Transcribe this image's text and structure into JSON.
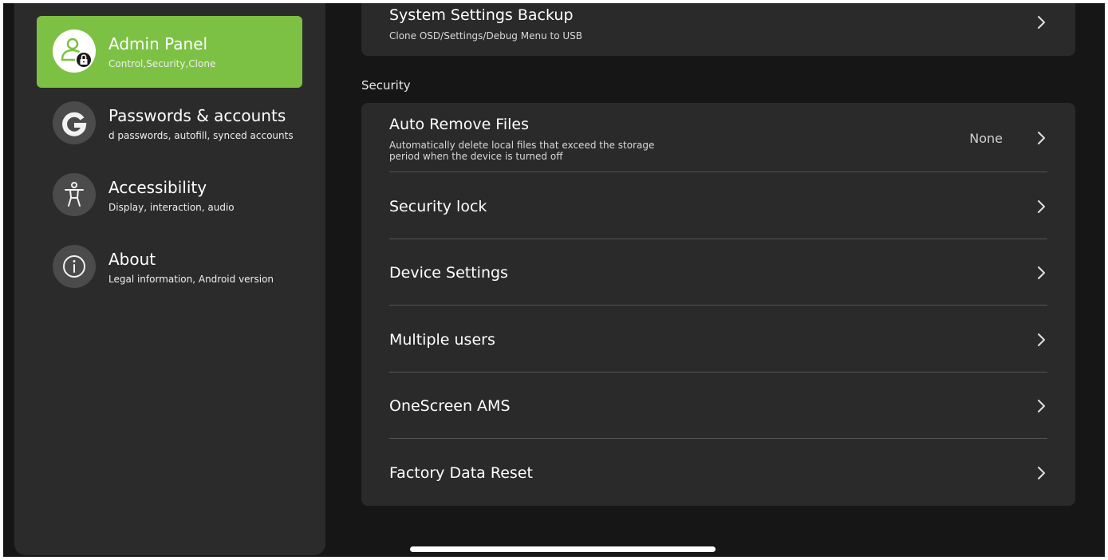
{
  "sidebar": {
    "items": [
      {
        "title": "Admin Panel",
        "subtitle": "Control,Security,Clone",
        "icon": "admin-user-lock-icon",
        "active": true
      },
      {
        "title": "Passwords & accounts",
        "subtitle": "d passwords, autofill, synced accounts",
        "icon": "google-g-icon",
        "active": false
      },
      {
        "title": "Accessibility",
        "subtitle": "Display, interaction, audio",
        "icon": "accessibility-icon",
        "active": false
      },
      {
        "title": "About",
        "subtitle": "Legal information, Android version",
        "icon": "info-icon",
        "active": false
      }
    ]
  },
  "backup": {
    "title": "System Settings Backup",
    "subtitle": "Clone OSD/Settings/Debug Menu to USB"
  },
  "security": {
    "header": "Security",
    "auto_remove": {
      "title": "Auto Remove Files",
      "subtitle_line1": "Automatically delete local files that exceed the storage",
      "subtitle_line2": "period when the device is turned off",
      "value": "None"
    },
    "rows": [
      {
        "title": "Security lock"
      },
      {
        "title": "Device Settings"
      },
      {
        "title": "Multiple users"
      },
      {
        "title": "OneScreen AMS"
      },
      {
        "title": "Factory Data Reset"
      }
    ]
  },
  "colors": {
    "accent": "#7cc144",
    "background": "#161616",
    "panel": "#2a2a2a"
  }
}
